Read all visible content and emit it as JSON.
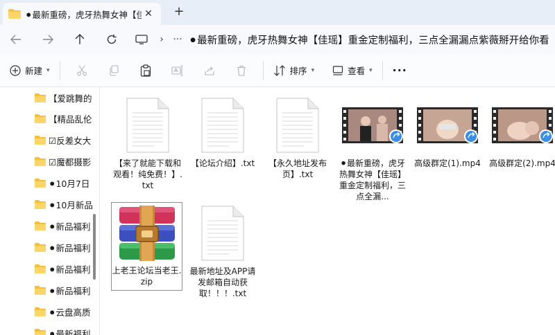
{
  "tab": {
    "title": "⚫最新重磅，虎牙热舞女神【佳瑶】重金定制福利，三点全漏漏点紫薇掰开给你看",
    "close": "✕",
    "new": "+"
  },
  "nav": {
    "breadcrumb": "⚫最新重磅，虎牙热舞女神【佳瑶】重金定制福利，三点全漏漏点紫薇掰开给你看",
    "more": "···",
    "chevron": "›"
  },
  "toolbar": {
    "new_label": "新建",
    "sort_label": "排序",
    "view_label": "查看",
    "more": "···"
  },
  "sidebar": {
    "items": [
      {
        "label": "【爱跳舞的"
      },
      {
        "label": "【精品乱伦"
      },
      {
        "label": "☑反差女大"
      },
      {
        "label": "☑魔都摄影"
      },
      {
        "label": "⚫10月7日"
      },
      {
        "label": "⚫10月新品"
      },
      {
        "label": "⚫新品福利"
      },
      {
        "label": "⚫新品福利"
      },
      {
        "label": "⚫新品福利"
      },
      {
        "label": "⚫新品福利"
      },
      {
        "label": "⚫云盘高质"
      },
      {
        "label": "⚫最新福利"
      }
    ]
  },
  "files": [
    {
      "name": "【来了就能下载和观看！纯免费！】.txt",
      "kind": "doc"
    },
    {
      "name": "【论坛介绍】.txt",
      "kind": "doc"
    },
    {
      "name": "【永久地址发布页】.txt",
      "kind": "doc"
    },
    {
      "name": "⚫最新重磅，虎牙热舞女神【佳瑶】重金定制福利，三点全漏...",
      "kind": "video"
    },
    {
      "name": "高级群定(1).mp4",
      "kind": "video"
    },
    {
      "name": "高级群定(2).mp4",
      "kind": "video"
    },
    {
      "name": "上老王论坛当老王.zip",
      "kind": "zip"
    },
    {
      "name": "最新地址及APP请发邮箱自动获取！！！.txt",
      "kind": "doc"
    }
  ]
}
